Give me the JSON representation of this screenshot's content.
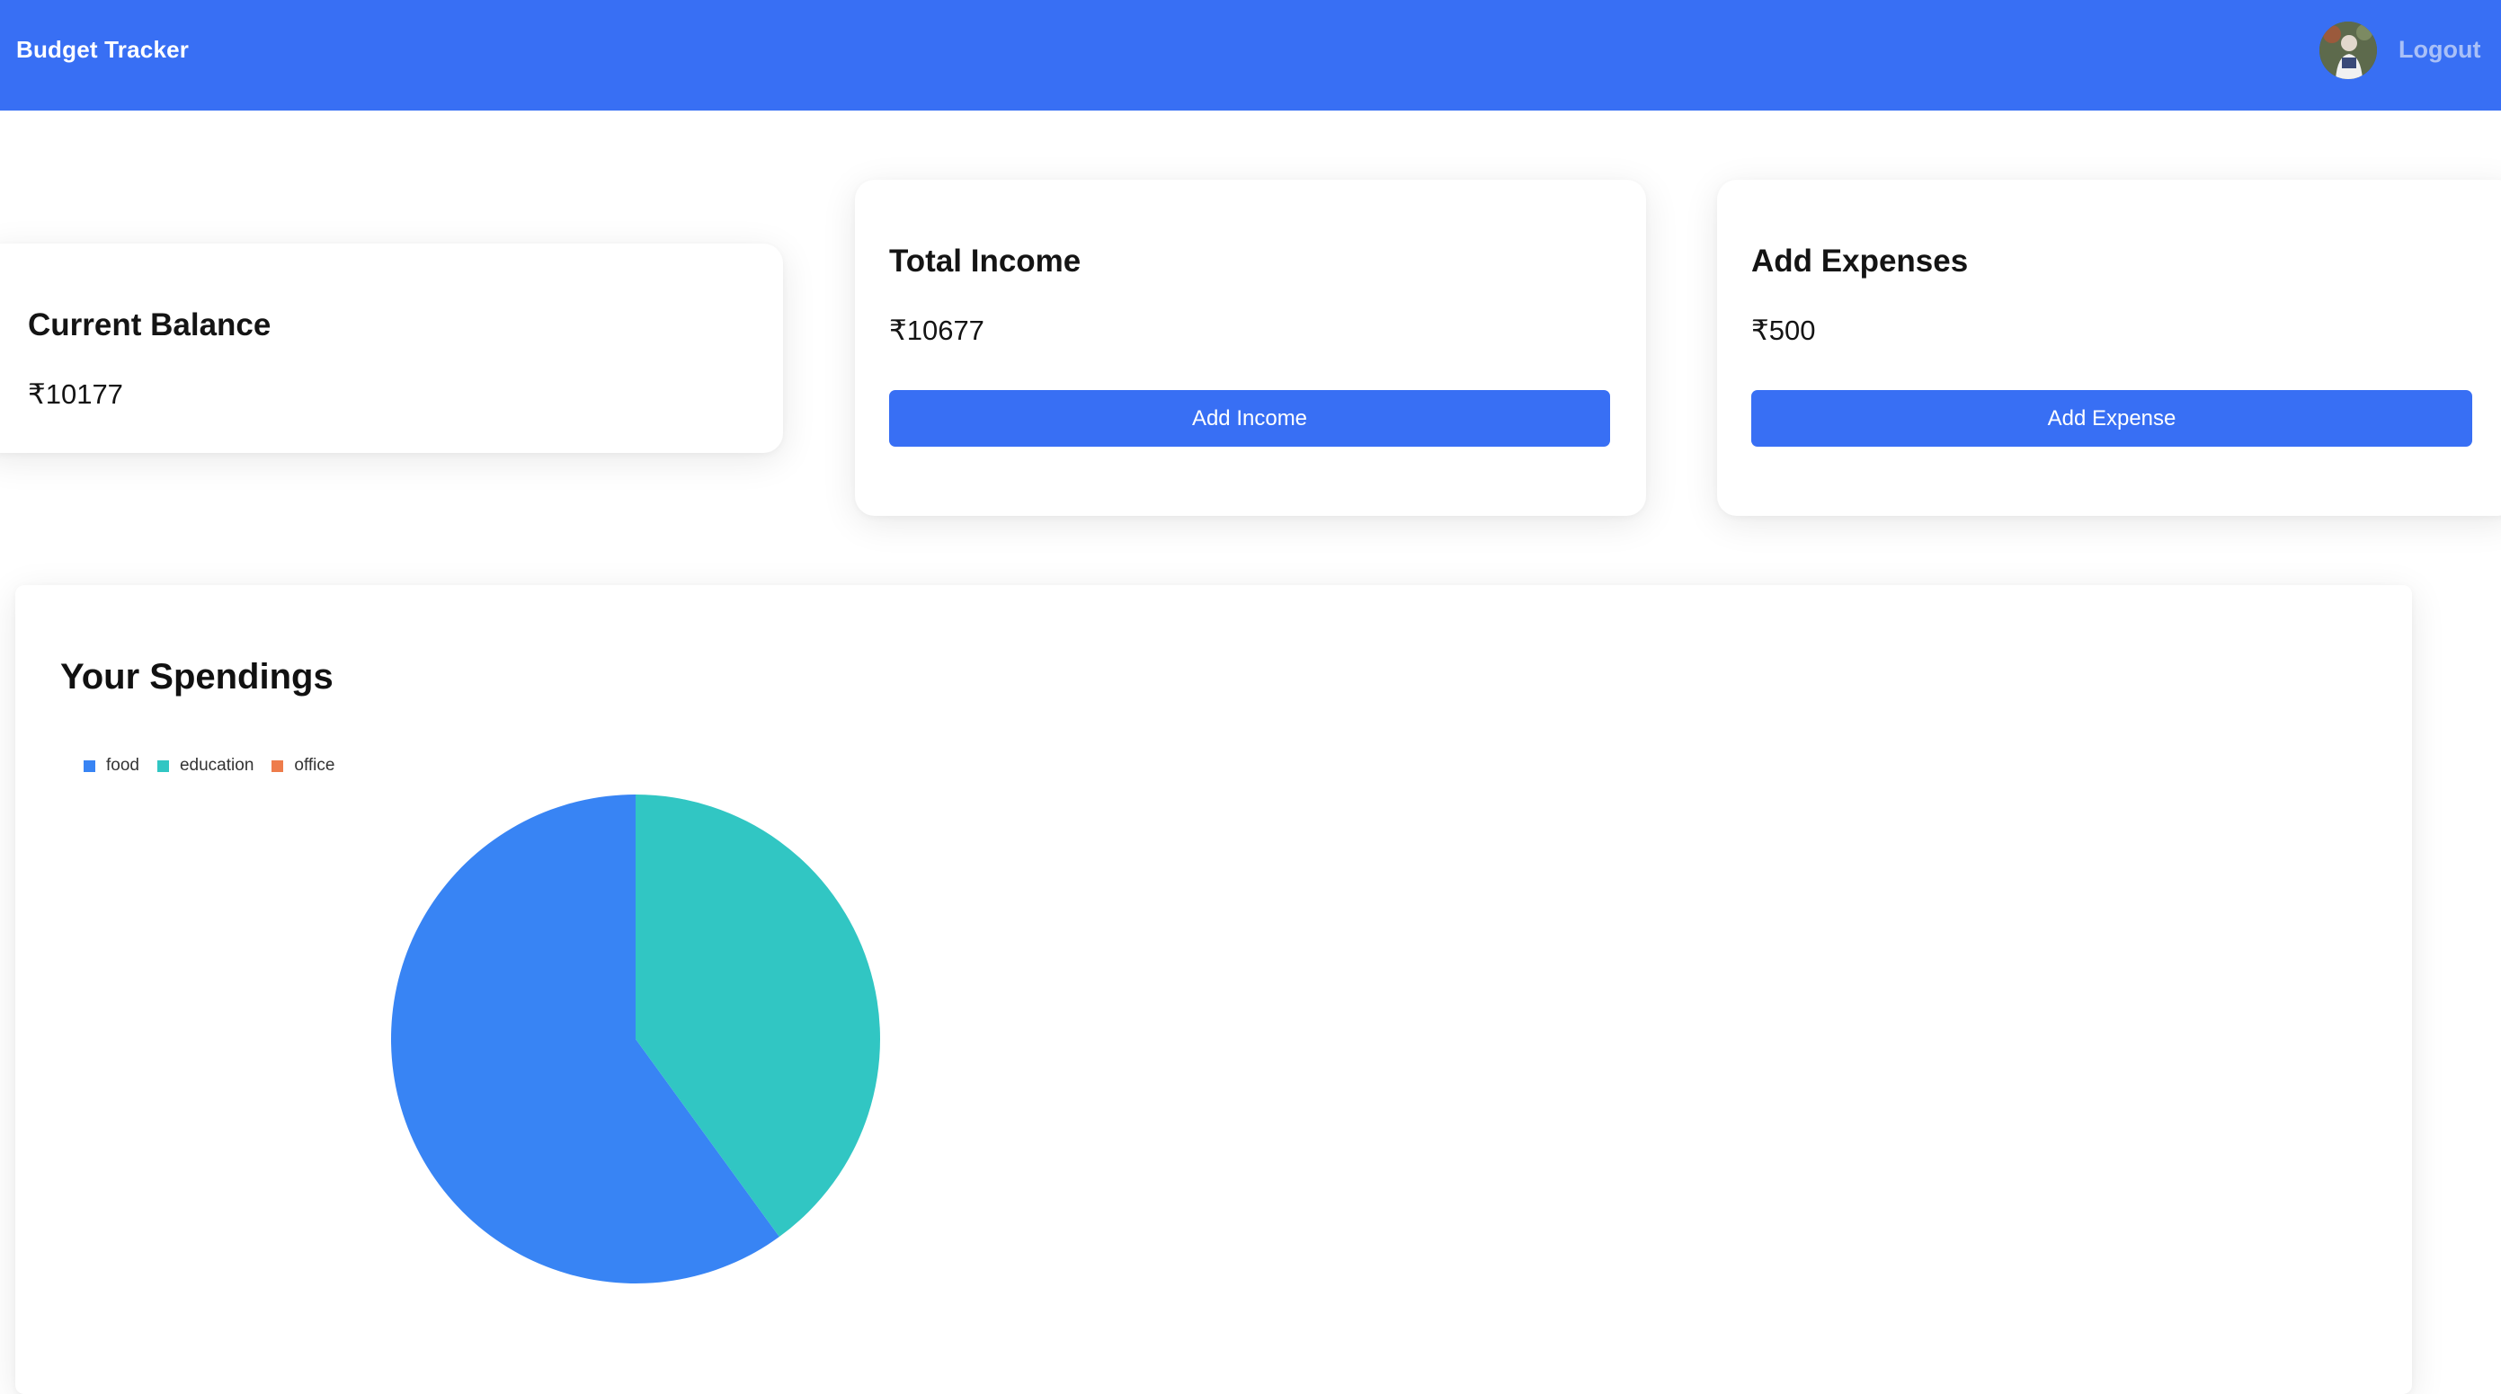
{
  "app": {
    "brand": "Budget Tracker",
    "logout_label": "Logout",
    "primary_color": "#386ff4"
  },
  "cards": {
    "balance": {
      "title": "Current Balance",
      "amount": "₹10177"
    },
    "income": {
      "title": "Total Income",
      "amount": "₹10677",
      "button_label": "Add Income"
    },
    "expenses": {
      "title": "Add Expenses",
      "amount": "₹500",
      "button_label": "Add Expense"
    }
  },
  "spendings": {
    "title": "Your Spendings"
  },
  "chart_data": {
    "type": "pie",
    "title": "",
    "legend_position": "top-left",
    "labels": [
      "food",
      "education",
      "office"
    ],
    "values": [
      60,
      40,
      0
    ],
    "colors": [
      "#3884f4",
      "#31c6c3",
      "#ee7c4b"
    ]
  }
}
